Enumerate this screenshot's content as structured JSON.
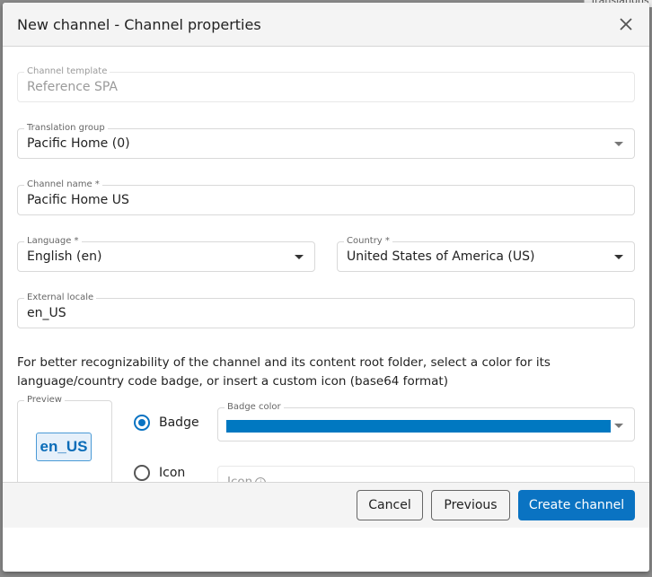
{
  "background": {
    "peek_text": "Translations"
  },
  "dialog": {
    "title": "New channel - Channel properties",
    "close_icon": "close-icon"
  },
  "form": {
    "channel_template": {
      "label": "Channel template",
      "value": "Reference SPA",
      "disabled": true
    },
    "translation_group": {
      "label": "Translation group",
      "value": "Pacific Home (0)"
    },
    "channel_name": {
      "label": "Channel name *",
      "value": "Pacific Home US"
    },
    "language": {
      "label": "Language *",
      "value": "English (en)"
    },
    "country": {
      "label": "Country *",
      "value": "United States of America (US)"
    },
    "external_locale": {
      "label": "External locale",
      "value": "en_US"
    },
    "description": "For better recognizability of the channel and its content root folder, select a color for its language/country code badge, or insert a custom icon (base64 format)",
    "preview": {
      "label": "Preview",
      "badge_text": "en_US"
    },
    "badge_option": {
      "label": "Badge",
      "selected": true
    },
    "icon_option": {
      "label": "Icon",
      "selected": false
    },
    "badge_color": {
      "label": "Badge color",
      "value": "#0078c1"
    },
    "icon_field": {
      "placeholder": "Icon",
      "info_icon": "info-icon"
    }
  },
  "footer": {
    "cancel_label": "Cancel",
    "previous_label": "Previous",
    "create_label": "Create channel"
  },
  "colors": {
    "primary": "#0a73c2",
    "badge_color": "#0078c1"
  }
}
